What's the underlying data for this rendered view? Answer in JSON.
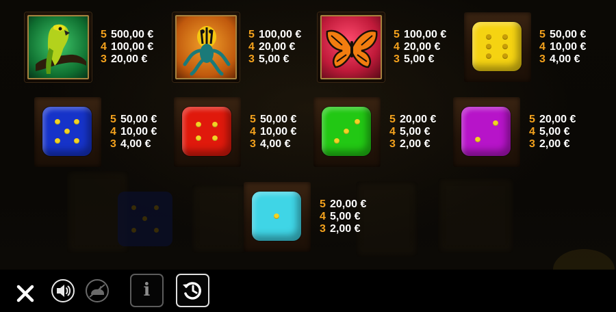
{
  "paytable": {
    "row1": [
      {
        "symbol": "parrot",
        "pays": [
          {
            "count": "5",
            "amount": "500,00 €"
          },
          {
            "count": "4",
            "amount": "100,00 €"
          },
          {
            "count": "3",
            "amount": "20,00 €"
          }
        ]
      },
      {
        "symbol": "frog",
        "pays": [
          {
            "count": "5",
            "amount": "100,00 €"
          },
          {
            "count": "4",
            "amount": "20,00 €"
          },
          {
            "count": "3",
            "amount": "5,00 €"
          }
        ]
      },
      {
        "symbol": "butterfly",
        "pays": [
          {
            "count": "5",
            "amount": "100,00 €"
          },
          {
            "count": "4",
            "amount": "20,00 €"
          },
          {
            "count": "3",
            "amount": "5,00 €"
          }
        ]
      },
      {
        "symbol": "yellow-dice-six",
        "pays": [
          {
            "count": "5",
            "amount": "50,00 €"
          },
          {
            "count": "4",
            "amount": "10,00 €"
          },
          {
            "count": "3",
            "amount": "4,00 €"
          }
        ]
      }
    ],
    "row2": [
      {
        "symbol": "blue-dice-five",
        "pays": [
          {
            "count": "5",
            "amount": "50,00 €"
          },
          {
            "count": "4",
            "amount": "10,00 €"
          },
          {
            "count": "3",
            "amount": "4,00 €"
          }
        ]
      },
      {
        "symbol": "red-dice-four",
        "pays": [
          {
            "count": "5",
            "amount": "50,00 €"
          },
          {
            "count": "4",
            "amount": "10,00 €"
          },
          {
            "count": "3",
            "amount": "4,00 €"
          }
        ]
      },
      {
        "symbol": "green-dice-three",
        "pays": [
          {
            "count": "5",
            "amount": "20,00 €"
          },
          {
            "count": "4",
            "amount": "5,00 €"
          },
          {
            "count": "3",
            "amount": "2,00 €"
          }
        ]
      },
      {
        "symbol": "purple-dice-two",
        "pays": [
          {
            "count": "5",
            "amount": "20,00 €"
          },
          {
            "count": "4",
            "amount": "5,00 €"
          },
          {
            "count": "3",
            "amount": "2,00 €"
          }
        ]
      }
    ],
    "row3": [
      {
        "symbol": "cyan-dice-one",
        "pays": [
          {
            "count": "5",
            "amount": "20,00 €"
          },
          {
            "count": "4",
            "amount": "5,00 €"
          },
          {
            "count": "3",
            "amount": "2,00 €"
          }
        ]
      }
    ]
  },
  "colors": {
    "count": "#f4a21d",
    "amount": "#ffffff",
    "yellow_die": "#f5d312",
    "blue_die": "#1633c9",
    "red_die": "#e0190c",
    "green_die": "#22c814",
    "purple_die": "#b714c9",
    "cyan_die": "#3fd5e6"
  },
  "controls": {
    "close": {
      "icon": "close-icon"
    },
    "sound": {
      "icon": "speaker-icon"
    },
    "turbo": {
      "icon": "rabbit-icon"
    },
    "info": {
      "icon": "info-icon",
      "label": "i"
    },
    "history": {
      "icon": "history-icon"
    }
  }
}
